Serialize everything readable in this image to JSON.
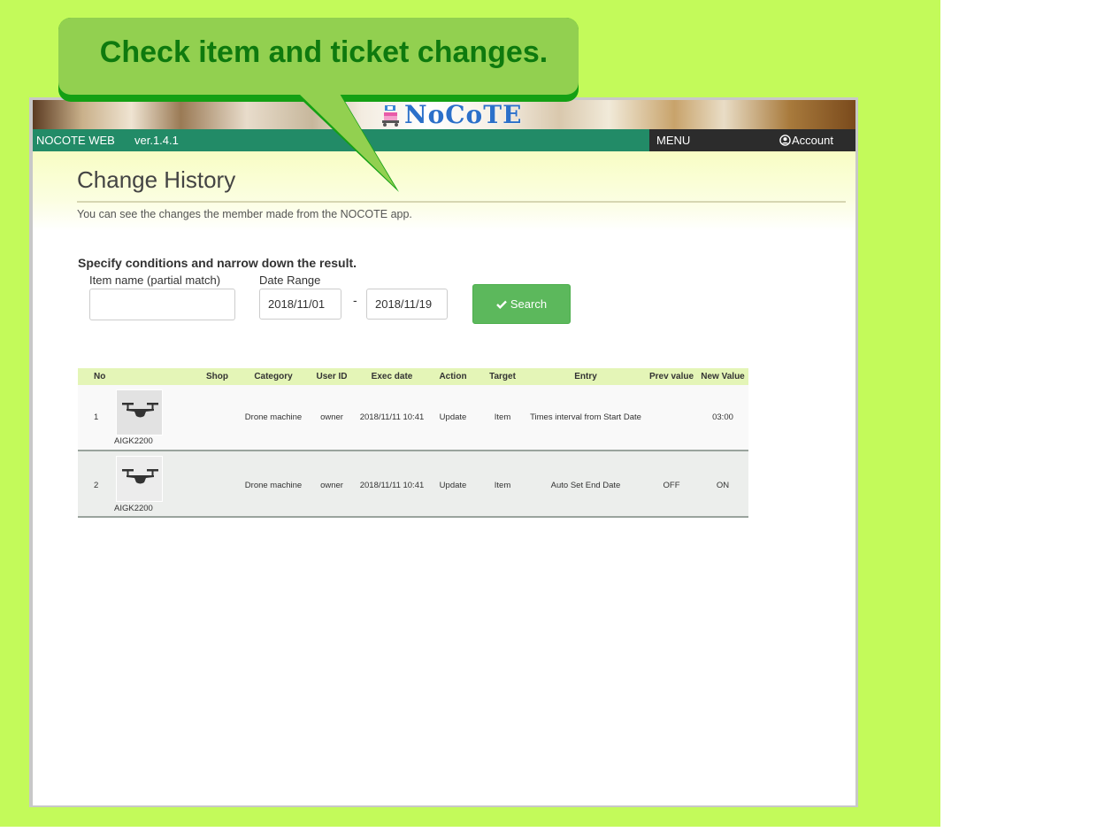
{
  "callout": {
    "text": "Check item and ticket changes."
  },
  "brand": {
    "logo": "NoCoTE"
  },
  "navbar": {
    "app_name": "NOCOTE WEB",
    "version": "ver.1.4.1",
    "menu_label": "MENU",
    "account_label": "Account"
  },
  "page": {
    "title": "Change History",
    "description": "You can see the changes the member made from the NOCOTE app."
  },
  "search": {
    "title": "Specify conditions and narrow down the result.",
    "item_name_label": "Item name (partial match)",
    "item_name_value": "",
    "date_range_label": "Date Range",
    "date_from": "2018/11/01",
    "date_separator": "-",
    "date_to": "2018/11/19",
    "button_label": "Search"
  },
  "table": {
    "headers": {
      "no": "No",
      "shop": "Shop",
      "category": "Category",
      "user_id": "User ID",
      "exec_date": "Exec date",
      "action": "Action",
      "target": "Target",
      "entry": "Entry",
      "prev_value": "Prev value",
      "new_value": "New Value"
    },
    "rows": [
      {
        "no": "1",
        "item_name": "AIGK2200",
        "shop": "",
        "category": "Drone machine",
        "user_id": "owner",
        "exec_date": "2018/11/11 10:41",
        "action": "Update",
        "target": "Item",
        "entry": "Times interval from Start Date",
        "prev_value": "",
        "new_value": "03:00"
      },
      {
        "no": "2",
        "item_name": "AIGK2200",
        "shop": "",
        "category": "Drone machine",
        "user_id": "owner",
        "exec_date": "2018/11/11 10:41",
        "action": "Update",
        "target": "Item",
        "entry": "Auto Set End Date",
        "prev_value": "OFF",
        "new_value": "ON"
      }
    ]
  },
  "colors": {
    "outer_bg": "#c3fa5a",
    "navbar": "#228b67",
    "nav_dark": "#2c2c2c",
    "search_button": "#5cb85c",
    "table_header": "#e4f5b7",
    "callout_fill": "#92d050",
    "callout_text": "#0e7a0e"
  },
  "icons": {
    "drone": "drone-icon",
    "check": "check-icon",
    "account": "user-circle-icon",
    "logo_mark": "nocote-logo-icon"
  }
}
